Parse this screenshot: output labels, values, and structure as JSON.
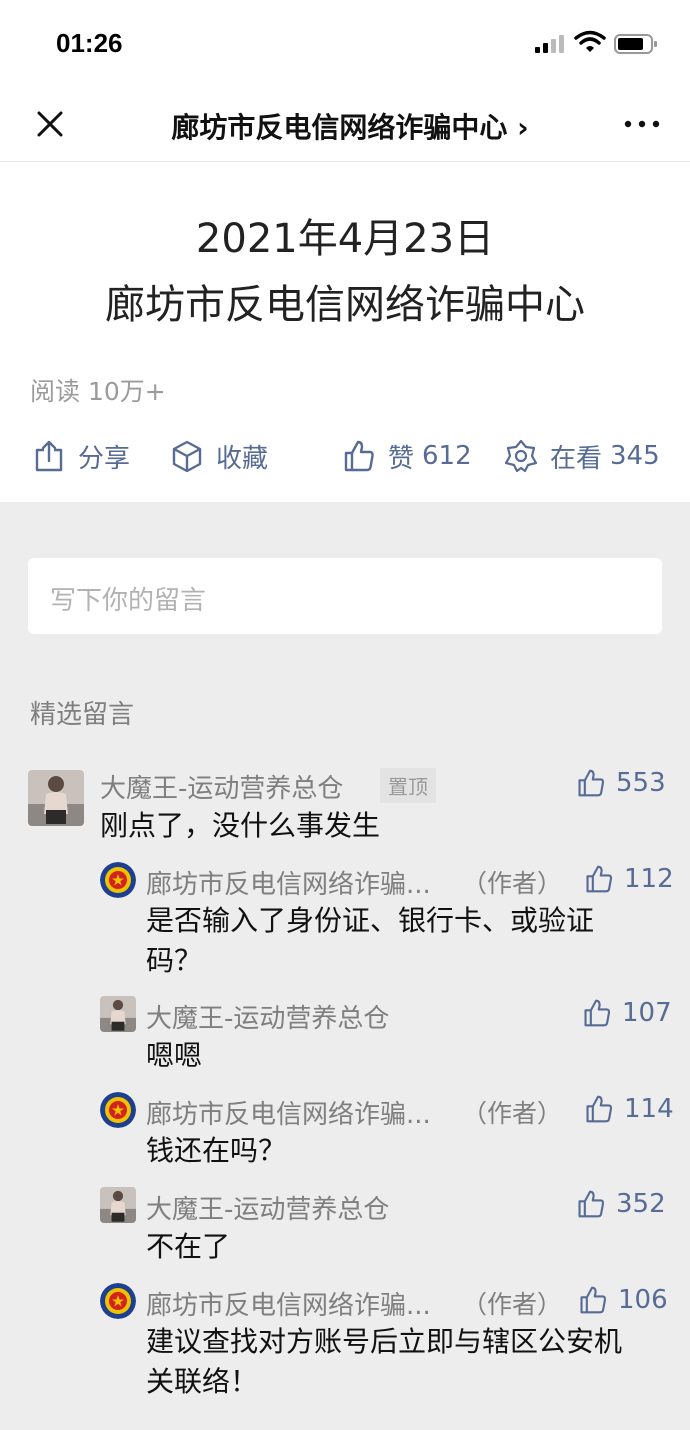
{
  "status": {
    "time": "01:26"
  },
  "nav": {
    "title": "廊坊市反电信网络诈骗中心 ›"
  },
  "message": {
    "date": "2021年4月23日",
    "body": "廊坊市反电信网络诈骗中心"
  },
  "reads": "阅读 10万+",
  "actions": {
    "share": "分享",
    "favorite": "收藏",
    "like_label": "赞",
    "like_count": "612",
    "watching_label": "在看",
    "watching_count": "345"
  },
  "comment_input": {
    "placeholder": "写下你的留言"
  },
  "section_title": "精选留言",
  "comments": [
    {
      "name": "大魔王-运动营养总仓",
      "pinned": "置顶",
      "likes": "553",
      "text": "刚点了，没什么事发生"
    },
    {
      "name": "廊坊市反电信网络诈骗...",
      "author": "（作者）",
      "likes": "112",
      "text_line1": "是否输入了身份证、银行卡、或验证",
      "text_line2": "码？"
    },
    {
      "name": "大魔王-运动营养总仓",
      "likes": "107",
      "text": "嗯嗯"
    },
    {
      "name": "廊坊市反电信网络诈骗...",
      "author": "（作者）",
      "likes": "114",
      "text": "钱还在吗？"
    },
    {
      "name": "大魔王-运动营养总仓",
      "likes": "352",
      "text": "不在了"
    },
    {
      "name": "廊坊市反电信网络诈骗...",
      "author": "（作者）",
      "likes": "106",
      "text_line1": "建议查找对方账号后立即与辖区公安机",
      "text_line2": "关联络！"
    }
  ],
  "colors": {
    "link": "#576b95",
    "gray_text": "#7f7f7f",
    "background": "#ededed"
  }
}
